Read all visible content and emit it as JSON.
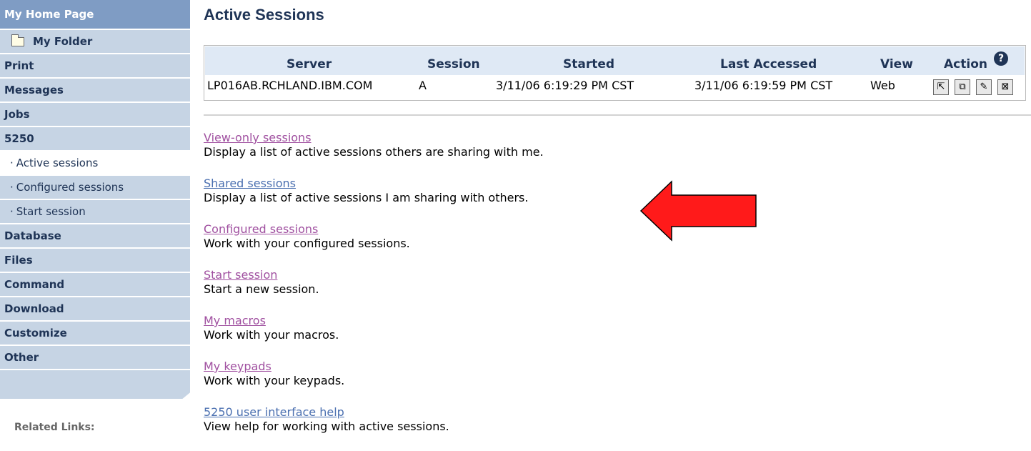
{
  "sidebar": {
    "home": "My Home Page",
    "folder": "My Folder",
    "items_top": [
      "Print",
      "Messages",
      "Jobs",
      "5250"
    ],
    "sub_items": [
      {
        "label": "Active sessions"
      },
      {
        "label": "Configured sessions"
      },
      {
        "label": "Start session"
      }
    ],
    "items_bottom": [
      "Database",
      "Files",
      "Command",
      "Download",
      "Customize",
      "Other"
    ],
    "related_links": "Related Links:"
  },
  "main": {
    "title": "Active Sessions",
    "table": {
      "headers": {
        "server": "Server",
        "session": "Session",
        "started": "Started",
        "last_accessed": "Last Accessed",
        "view": "View",
        "action": "Action"
      },
      "rows": [
        {
          "server": "LP016AB.RCHLAND.IBM.COM",
          "session": "A",
          "started": "3/11/06 6:19:29 PM CST",
          "last_accessed": "3/11/06 6:19:59 PM CST",
          "view": "Web"
        }
      ]
    },
    "links": [
      {
        "label": "View-only sessions",
        "desc": "Display a list of active sessions others are sharing with me."
      },
      {
        "label": "Shared sessions",
        "desc": "Display a list of active sessions I am sharing with others."
      },
      {
        "label": "Configured sessions",
        "desc": "Work with your configured sessions."
      },
      {
        "label": "Start session",
        "desc": "Start a new session."
      },
      {
        "label": "My macros",
        "desc": "Work with your macros."
      },
      {
        "label": "My keypads",
        "desc": "Work with your keypads."
      },
      {
        "label": "5250 user interface help",
        "desc": "View help for working with active sessions."
      }
    ]
  },
  "icons": {
    "help": "question-circle-icon",
    "actions": [
      "open-session-icon",
      "share-session-icon",
      "edit-session-icon",
      "stop-session-icon"
    ],
    "annotation": "red-arrow-icon"
  },
  "colors": {
    "nav_bg": "#c6d4e4",
    "nav_home_bg": "#7f9cc4",
    "nav_text": "#1f3456",
    "link_visited": "#a050a0",
    "link_blue": "#4a6fb0",
    "arrow": "#ff1a1a"
  }
}
